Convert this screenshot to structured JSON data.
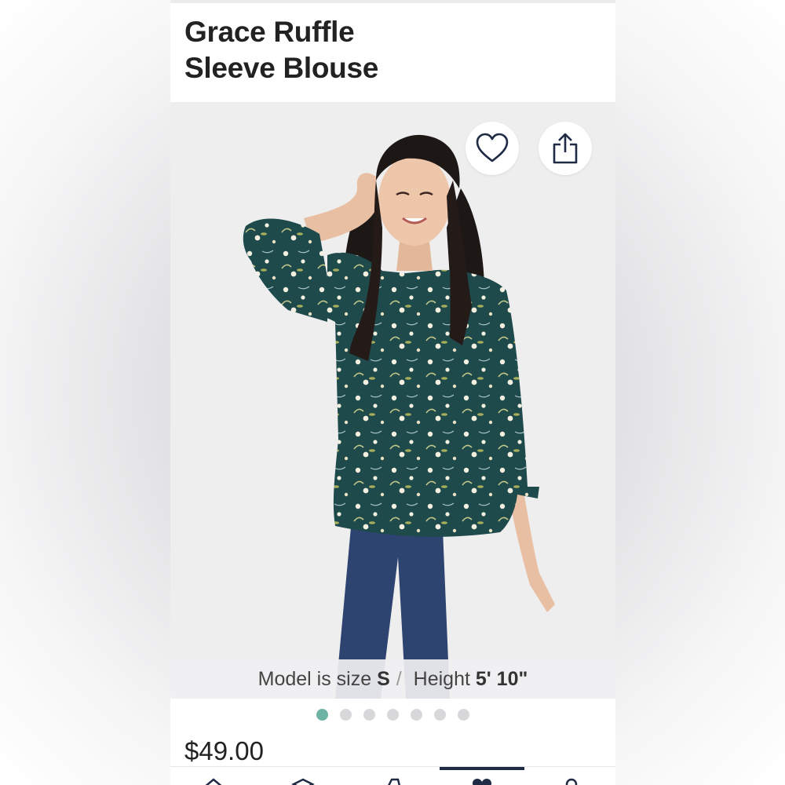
{
  "product": {
    "title_line1": "Grace Ruffle",
    "title_line2": "Sleeve Blouse",
    "price": "$49.00"
  },
  "image_overlay": {
    "model_prefix": "Model is size ",
    "model_size": "S",
    "separator": "/",
    "height_prefix": " Height ",
    "model_height": "5' 10\""
  },
  "actions": {
    "favorite_icon": "heart-outline-icon",
    "share_icon": "share-icon"
  },
  "carousel": {
    "total": 7,
    "active_index": 0
  },
  "bottom_nav": {
    "items": [
      "home-icon",
      "box-icon",
      "tag-icon",
      "heart-icon",
      "user-icon"
    ],
    "active_index": 3
  },
  "colors": {
    "accent_dot": "#6fb3a4",
    "nav_active": "#1f2a44",
    "blouse": "#1f4a4c",
    "jeans": "#2d4370"
  }
}
